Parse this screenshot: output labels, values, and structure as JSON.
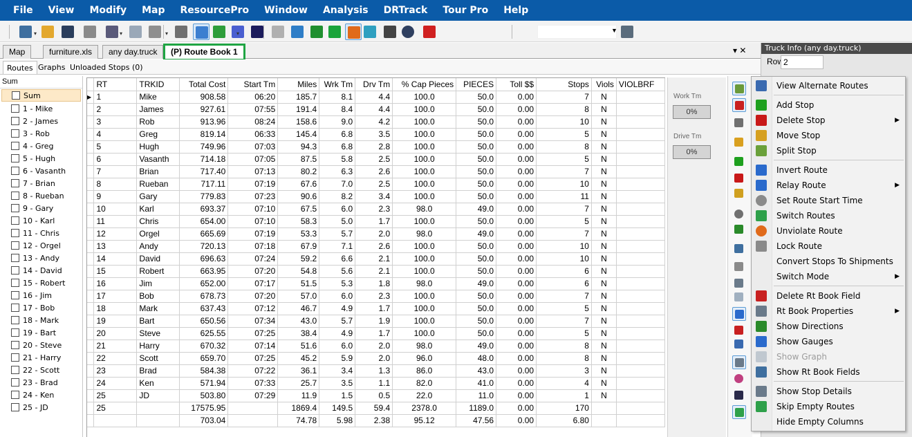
{
  "menubar": {
    "items": [
      "File",
      "View",
      "Modify",
      "Map",
      "ResourcePro",
      "Window",
      "Analysis",
      "DRTrack",
      "Tour Pro",
      "Help"
    ]
  },
  "toolbar": {
    "icons": [
      "binder-icon",
      "folder-open-icon",
      "save-icon",
      "clipboard-icon",
      "wrench-icon",
      "map-tile-icon",
      "truck-icon",
      "filter-icon",
      "pointer-icon",
      "zoom-icon",
      "lasso-icon",
      "route-select-icon",
      "pencil-icon",
      "network-icon",
      "pin-icon",
      "play-icon",
      "optimize-icon",
      "sequence-icon",
      "tools-icon",
      "globe-icon",
      "close-x-icon",
      "window-icon"
    ],
    "combo_value": ""
  },
  "doc_tabs": [
    {
      "label": "Map"
    },
    {
      "label": "furniture.xls"
    },
    {
      "label": "any day.truck"
    },
    {
      "label": "(P) Route Book 1"
    }
  ],
  "tabs_ctrl": "▾ ✕",
  "sub_tabs": [
    {
      "label": "Routes"
    },
    {
      "label": "Graphs"
    },
    {
      "label": "Unloaded Stops (0)"
    }
  ],
  "route_list": {
    "header": "Sum",
    "items": [
      "Sum",
      "1 - Mike",
      "2 - James",
      "3 - Rob",
      "4 - Greg",
      "5 - Hugh",
      "6 - Vasanth",
      "7 - Brian",
      "8 - Rueban",
      "9 - Gary",
      "10 - Karl",
      "11 - Chris",
      "12 - Orgel",
      "13 - Andy",
      "14 - David",
      "15 - Robert",
      "16 - Jim",
      "17 - Bob",
      "18 - Mark",
      "19 - Bart",
      "20 - Steve",
      "21 - Harry",
      "22 - Scott",
      "23 - Brad",
      "24 - Ken",
      "25 - JD"
    ]
  },
  "grid": {
    "columns": [
      "RT",
      "TRKID",
      "Total Cost",
      "Start Tm",
      "Miles",
      "Wrk Tm",
      "Drv Tm",
      "% Cap Pieces",
      "PIECES",
      "Toll $$",
      "Stops",
      "Viols",
      "VIOLBRF"
    ],
    "rows": [
      [
        "1",
        "Mike",
        "908.58",
        "06:20",
        "185.7",
        "8.1",
        "4.4",
        "100.0",
        "50.0",
        "0.00",
        "7",
        "N",
        ""
      ],
      [
        "2",
        "James",
        "927.61",
        "07:55",
        "191.4",
        "8.4",
        "4.4",
        "100.0",
        "50.0",
        "0.00",
        "8",
        "N",
        ""
      ],
      [
        "3",
        "Rob",
        "913.96",
        "08:24",
        "158.6",
        "9.0",
        "4.2",
        "100.0",
        "50.0",
        "0.00",
        "10",
        "N",
        ""
      ],
      [
        "4",
        "Greg",
        "819.14",
        "06:33",
        "145.4",
        "6.8",
        "3.5",
        "100.0",
        "50.0",
        "0.00",
        "5",
        "N",
        ""
      ],
      [
        "5",
        "Hugh",
        "749.96",
        "07:03",
        "94.3",
        "6.8",
        "2.8",
        "100.0",
        "50.0",
        "0.00",
        "8",
        "N",
        ""
      ],
      [
        "6",
        "Vasanth",
        "714.18",
        "07:05",
        "87.5",
        "5.8",
        "2.5",
        "100.0",
        "50.0",
        "0.00",
        "5",
        "N",
        ""
      ],
      [
        "7",
        "Brian",
        "717.40",
        "07:13",
        "80.2",
        "6.3",
        "2.6",
        "100.0",
        "50.0",
        "0.00",
        "7",
        "N",
        ""
      ],
      [
        "8",
        "Rueban",
        "717.11",
        "07:19",
        "67.6",
        "7.0",
        "2.5",
        "100.0",
        "50.0",
        "0.00",
        "10",
        "N",
        ""
      ],
      [
        "9",
        "Gary",
        "779.83",
        "07:23",
        "90.6",
        "8.2",
        "3.4",
        "100.0",
        "50.0",
        "0.00",
        "11",
        "N",
        ""
      ],
      [
        "10",
        "Karl",
        "693.37",
        "07:10",
        "67.5",
        "6.0",
        "2.3",
        "98.0",
        "49.0",
        "0.00",
        "7",
        "N",
        ""
      ],
      [
        "11",
        "Chris",
        "654.00",
        "07:10",
        "58.3",
        "5.0",
        "1.7",
        "100.0",
        "50.0",
        "0.00",
        "5",
        "N",
        ""
      ],
      [
        "12",
        "Orgel",
        "665.69",
        "07:19",
        "53.3",
        "5.7",
        "2.0",
        "98.0",
        "49.0",
        "0.00",
        "7",
        "N",
        ""
      ],
      [
        "13",
        "Andy",
        "720.13",
        "07:18",
        "67.9",
        "7.1",
        "2.6",
        "100.0",
        "50.0",
        "0.00",
        "10",
        "N",
        ""
      ],
      [
        "14",
        "David",
        "696.63",
        "07:24",
        "59.2",
        "6.6",
        "2.1",
        "100.0",
        "50.0",
        "0.00",
        "10",
        "N",
        ""
      ],
      [
        "15",
        "Robert",
        "663.95",
        "07:20",
        "54.8",
        "5.6",
        "2.1",
        "100.0",
        "50.0",
        "0.00",
        "6",
        "N",
        ""
      ],
      [
        "16",
        "Jim",
        "652.00",
        "07:17",
        "51.5",
        "5.3",
        "1.8",
        "98.0",
        "49.0",
        "0.00",
        "6",
        "N",
        ""
      ],
      [
        "17",
        "Bob",
        "678.73",
        "07:20",
        "57.0",
        "6.0",
        "2.3",
        "100.0",
        "50.0",
        "0.00",
        "7",
        "N",
        ""
      ],
      [
        "18",
        "Mark",
        "637.43",
        "07:12",
        "46.7",
        "4.9",
        "1.7",
        "100.0",
        "50.0",
        "0.00",
        "5",
        "N",
        ""
      ],
      [
        "19",
        "Bart",
        "650.56",
        "07:34",
        "43.0",
        "5.7",
        "1.9",
        "100.0",
        "50.0",
        "0.00",
        "7",
        "N",
        ""
      ],
      [
        "20",
        "Steve",
        "625.55",
        "07:25",
        "38.4",
        "4.9",
        "1.7",
        "100.0",
        "50.0",
        "0.00",
        "5",
        "N",
        ""
      ],
      [
        "21",
        "Harry",
        "670.32",
        "07:14",
        "51.6",
        "6.0",
        "2.0",
        "98.0",
        "49.0",
        "0.00",
        "8",
        "N",
        ""
      ],
      [
        "22",
        "Scott",
        "659.70",
        "07:25",
        "45.2",
        "5.9",
        "2.0",
        "96.0",
        "48.0",
        "0.00",
        "8",
        "N",
        ""
      ],
      [
        "23",
        "Brad",
        "584.38",
        "07:22",
        "36.1",
        "3.4",
        "1.3",
        "86.0",
        "43.0",
        "0.00",
        "3",
        "N",
        ""
      ],
      [
        "24",
        "Ken",
        "571.94",
        "07:33",
        "25.7",
        "3.5",
        "1.1",
        "82.0",
        "41.0",
        "0.00",
        "4",
        "N",
        ""
      ],
      [
        "25",
        "JD",
        "503.80",
        "07:29",
        "11.9",
        "1.5",
        "0.5",
        "22.0",
        "11.0",
        "0.00",
        "1",
        "N",
        ""
      ]
    ],
    "totals": [
      [
        "25",
        "",
        "17575.95",
        "",
        "1869.4",
        "149.5",
        "59.4",
        "2378.0",
        "1189.0",
        "0.00",
        "170",
        "",
        ""
      ],
      [
        "",
        "",
        "703.04",
        "",
        "74.78",
        "5.98",
        "2.38",
        "95.12",
        "47.56",
        "0.00",
        "6.80",
        "",
        ""
      ]
    ]
  },
  "gauges": {
    "work_label": "Work Tm",
    "work_value": "0%",
    "drive_label": "Drive Tm",
    "drive_value": "0%"
  },
  "right_panel": {
    "title": "Truck Info (any day.truck)",
    "row_label": "Row",
    "row_value": "2"
  },
  "context_menu": [
    {
      "label": "View Alternate Routes",
      "icon": "alternate-routes-icon"
    },
    {
      "sep": true
    },
    {
      "label": "Add Stop",
      "icon": "add-icon"
    },
    {
      "label": "Delete Stop",
      "icon": "delete-icon",
      "submenu": true
    },
    {
      "label": "Move Stop",
      "icon": "move-icon"
    },
    {
      "label": "Split Stop",
      "icon": "split-icon"
    },
    {
      "sep": true
    },
    {
      "label": "Invert Route",
      "icon": "invert-icon"
    },
    {
      "label": "Relay Route",
      "icon": "flag-icon",
      "submenu": true
    },
    {
      "label": "Set Route Start Time",
      "icon": "clock-icon"
    },
    {
      "label": "Switch Routes",
      "icon": "switch-icon"
    },
    {
      "label": "Unviolate Route",
      "icon": "unviolate-icon"
    },
    {
      "label": "Lock Route",
      "icon": "lock-icon"
    },
    {
      "label": "Convert Stops To Shipments",
      "icon": ""
    },
    {
      "label": "Switch Mode",
      "icon": "",
      "submenu": true
    },
    {
      "sep": true
    },
    {
      "label": "Delete Rt Book Field",
      "icon": "delete-field-icon"
    },
    {
      "label": "Rt Book Properties",
      "icon": "properties-icon",
      "submenu": true
    },
    {
      "label": "Show Directions",
      "icon": "directions-icon"
    },
    {
      "label": "Show Gauges",
      "icon": "gauges-icon"
    },
    {
      "label": "Show Graph",
      "icon": "graph-icon",
      "disabled": true
    },
    {
      "label": "Show Rt Book Fields",
      "icon": "fields-icon"
    },
    {
      "sep": true
    },
    {
      "label": "Show Stop Details",
      "icon": "stop-details-icon"
    },
    {
      "label": "Skip Empty Routes",
      "icon": "skip-icon"
    },
    {
      "label": "Hide Empty Columns",
      "icon": ""
    }
  ]
}
